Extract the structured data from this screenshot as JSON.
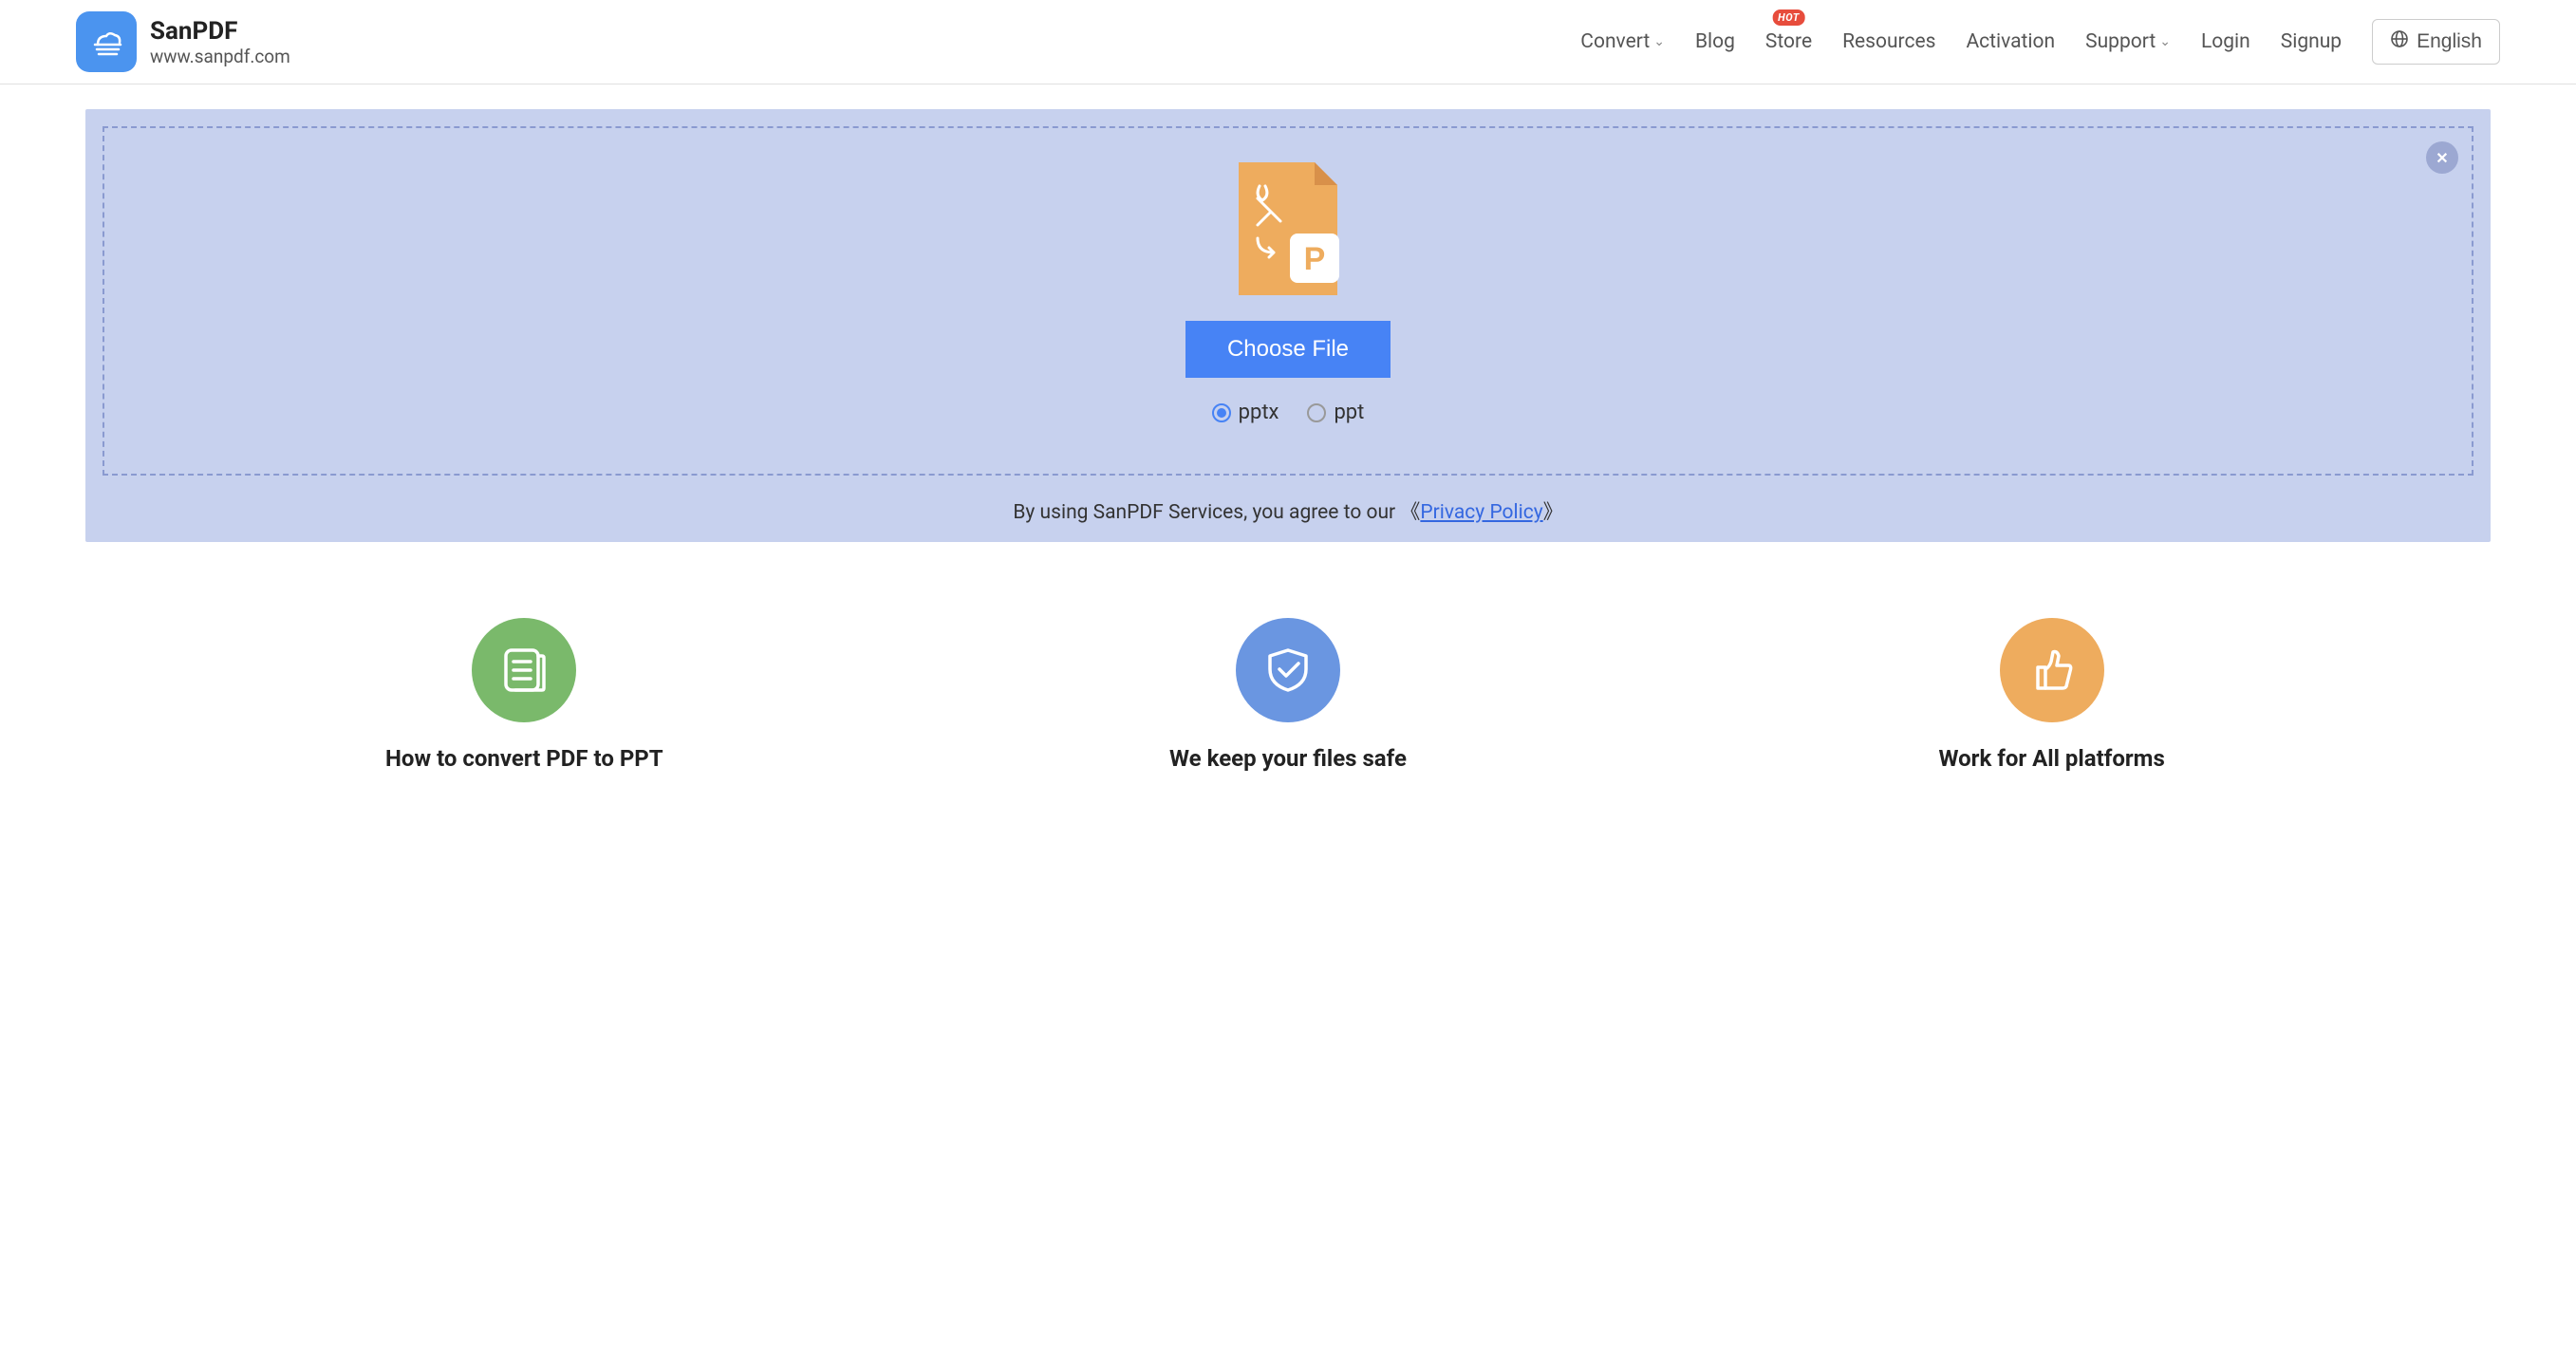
{
  "brand": {
    "name": "SanPDF",
    "url": "www.sanpdf.com"
  },
  "nav": {
    "convert": "Convert",
    "blog": "Blog",
    "store": "Store",
    "store_badge": "HOT",
    "resources": "Resources",
    "activation": "Activation",
    "support": "Support",
    "login": "Login",
    "signup": "Signup",
    "language": "English"
  },
  "upload": {
    "choose_file": "Choose File",
    "options": {
      "pptx": "pptx",
      "ppt": "ppt"
    },
    "agree_prefix": "By using SanPDF Services, you agree to our 《",
    "agree_link": "Privacy Policy",
    "agree_suffix": "》"
  },
  "features": [
    {
      "title": "How to convert PDF to PPT"
    },
    {
      "title": "We keep your files safe"
    },
    {
      "title": "Work for All platforms"
    }
  ]
}
